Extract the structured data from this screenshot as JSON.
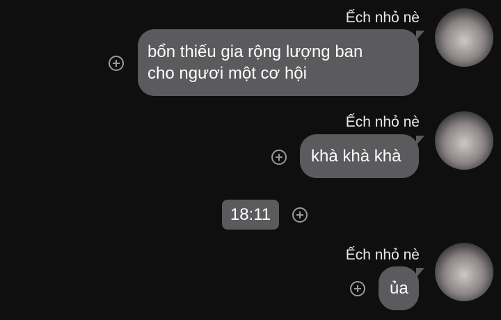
{
  "messages": [
    {
      "sender": "Ếch nhỏ nè",
      "text": "bổn thiếu gia rộng lượng ban cho ngươi một cơ hội",
      "line1": "bổn thiếu gia rộng lượng ban",
      "line2": "cho ngươi một cơ hội"
    },
    {
      "sender": "Ếch nhỏ nè",
      "text": "khà khà khà"
    },
    {
      "sender": "Ếch nhỏ nè",
      "text": "ủa"
    }
  ],
  "timestamp": "18:11",
  "icons": {
    "react": "add-reaction-icon",
    "avatar": "user-avatar"
  },
  "colors": {
    "background": "#0f0f10",
    "bubble": "#5b5b5e",
    "text": "#ffffff",
    "icon": "#9a9a9a"
  }
}
